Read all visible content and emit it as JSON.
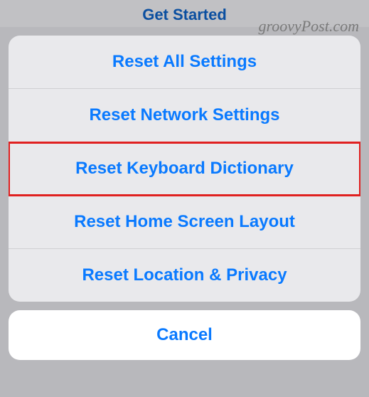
{
  "header": {
    "title": "Get Started"
  },
  "watermark": "groovyPost.com",
  "actionSheet": {
    "items": [
      {
        "label": "Reset All Settings"
      },
      {
        "label": "Reset Network Settings"
      },
      {
        "label": "Reset Keyboard Dictionary"
      },
      {
        "label": "Reset Home Screen Layout"
      },
      {
        "label": "Reset Location & Privacy"
      }
    ],
    "cancel": "Cancel"
  }
}
